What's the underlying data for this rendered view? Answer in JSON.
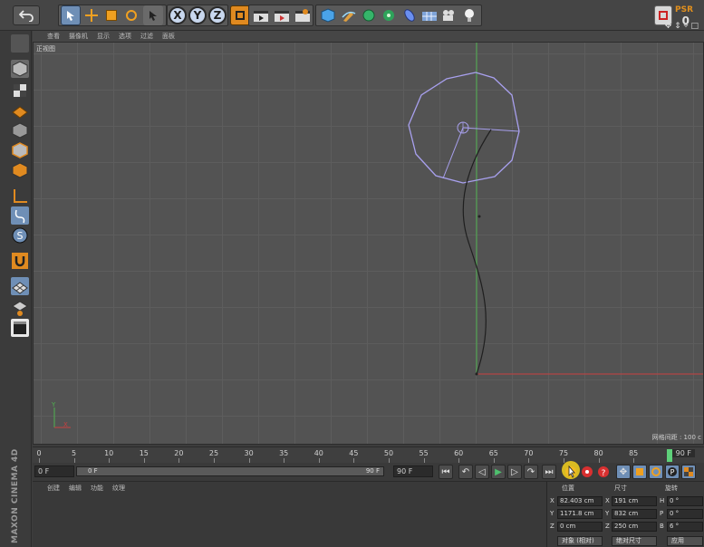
{
  "app": {
    "colors": {
      "accent": "#e2901d",
      "spline": "#1f1f1f",
      "circle": "#a8a0ee",
      "y_axis": "#4fb04f",
      "x_axis": "#c84040",
      "timeline_marker": "#5ed07a",
      "cursor_highlight": "#f6d21e"
    }
  },
  "toolbar": {
    "icons": [
      "undo-icon",
      "select-icon",
      "move-icon",
      "scale-icon",
      "rotate-icon",
      "live-select-icon",
      "axis-x",
      "axis-y",
      "axis-z",
      "coord-system-icon",
      "render-view-icon",
      "render-icon",
      "render-settings-icon",
      "cube-icon",
      "pen-icon",
      "subdivision-icon",
      "array-icon",
      "deformer-icon",
      "floor-icon",
      "camera-icon",
      "light-icon"
    ],
    "axis_labels": [
      "X",
      "Y",
      "Z"
    ],
    "psr_label": "PSR",
    "psr_value": "0"
  },
  "viewport": {
    "menu": [
      "查看",
      "摄像机",
      "显示",
      "选项",
      "过滤",
      "面板"
    ],
    "title": "正视图",
    "status": "网格间距 : 100 c",
    "nav_icons": "✥ ⇕ ⌖ □"
  },
  "timeline": {
    "ticks": [
      "0",
      "5",
      "10",
      "15",
      "20",
      "25",
      "30",
      "35",
      "40",
      "45",
      "50",
      "55",
      "60",
      "65",
      "70",
      "75",
      "80",
      "85"
    ],
    "end_frame": "90 F"
  },
  "transport": {
    "current_frame": "0 F",
    "slider_start": "0 F",
    "slider_end": "90 F",
    "max_frame": "90 F"
  },
  "material_panel": {
    "menu": [
      "创建",
      "编辑",
      "功能",
      "纹理"
    ]
  },
  "coordinates": {
    "headers": [
      "位置",
      "尺寸",
      "旋转"
    ],
    "rows": [
      {
        "axis": "X",
        "pos": "82.403 cm",
        "size_axis": "X",
        "size": "191 cm",
        "rot_axis": "H",
        "rot": "0 °"
      },
      {
        "axis": "Y",
        "pos": "1171.8 cm",
        "size_axis": "Y",
        "size": "832 cm",
        "rot_axis": "P",
        "rot": "0 °"
      },
      {
        "axis": "Z",
        "pos": "0 cm",
        "size_axis": "Z",
        "size": "250 cm",
        "rot_axis": "B",
        "rot": "6 °"
      }
    ],
    "mode_object": "对象 (相对)",
    "mode_size": "绝对尺寸",
    "apply": "应用"
  },
  "brand": {
    "text": "MAXON CINEMA 4D"
  }
}
